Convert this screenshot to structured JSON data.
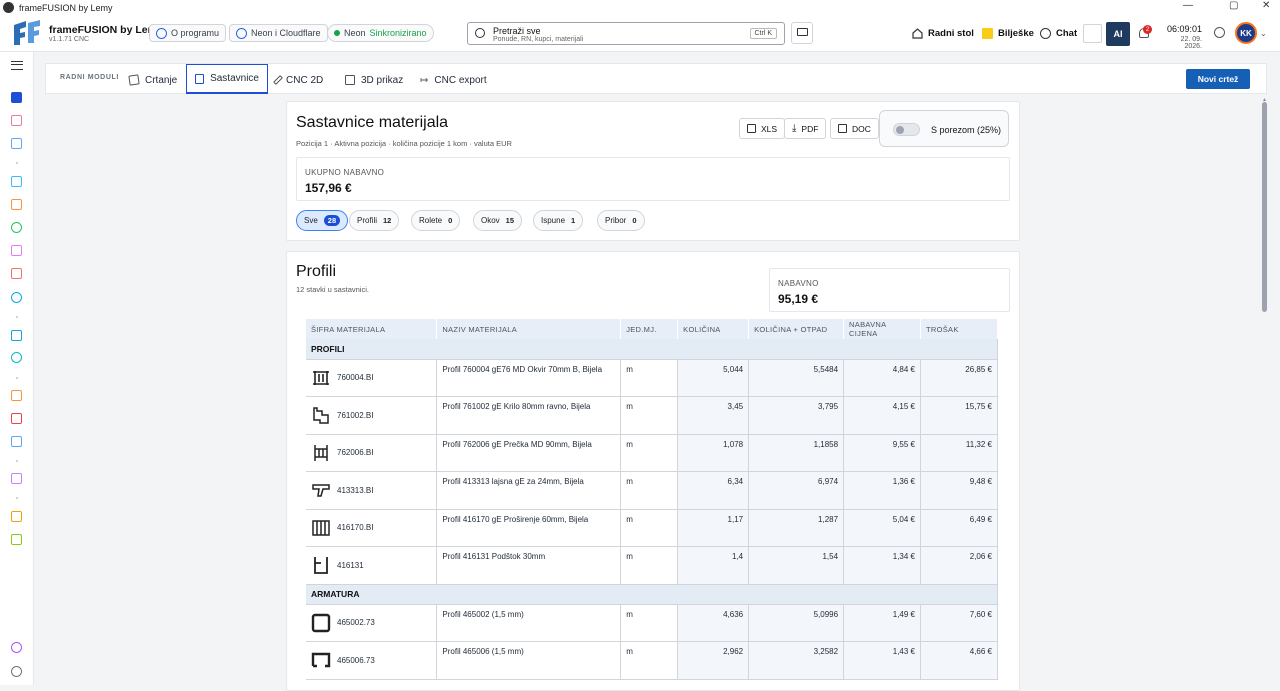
{
  "window": {
    "title": "frameFUSION by Lemy"
  },
  "brand": {
    "name": "frameFUSION by Lemy",
    "version": "v1.1.71 CNC"
  },
  "header": {
    "about_label": "O programu",
    "neon_cloudflare_label": "Neon i Cloudflare",
    "neon_label": "Neon",
    "neon_status": "Sinkronizirano",
    "search_title": "Pretraži sve",
    "search_sub": "Ponude, RN, kupci, materijali",
    "search_shortcut": "Ctrl K",
    "desktop_label": "Radni stol",
    "notes_label": "Bilješke",
    "chat_label": "Chat",
    "ai_label": "AI",
    "notif_count": "2",
    "time": "06:09:01",
    "date": "22. 09. 2026.",
    "user_initials": "KK"
  },
  "modules": {
    "label": "RADNI MODULI",
    "tabs": [
      {
        "label": "Crtanje"
      },
      {
        "label": "Sastavnice"
      },
      {
        "label": "CNC 2D"
      },
      {
        "label": "3D prikaz"
      },
      {
        "label": "CNC export"
      }
    ],
    "new_drawing": "Novi crtež"
  },
  "summary": {
    "title": "Sastavnice materijala",
    "subtitle": "Pozicija 1 · Aktivna pozicija · količina pozicije 1 kom · valuta EUR",
    "export": {
      "xls": "XLS",
      "pdf": "PDF",
      "doc": "DOC"
    },
    "tax_label": "S porezom (25%)",
    "total_label": "UKUPNO NABAVNO",
    "total_value": "157,96 €",
    "filters": [
      {
        "label": "Sve",
        "count": "28"
      },
      {
        "label": "Profili",
        "count": "12"
      },
      {
        "label": "Rolete",
        "count": "0"
      },
      {
        "label": "Okov",
        "count": "15"
      },
      {
        "label": "Ispune",
        "count": "1"
      },
      {
        "label": "Pribor",
        "count": "0"
      }
    ]
  },
  "profili": {
    "title": "Profili",
    "subtitle": "12 stavki u sastavnici.",
    "nab_label": "NABAVNO",
    "nab_value": "95,19 €",
    "columns": [
      "ŠIFRA MATERIJALA",
      "NAZIV MATERIJALA",
      "JED.MJ.",
      "KOLIČINA",
      "KOLIČINA + OTPAD",
      "NABAVNA CIJENA",
      "TROŠAK"
    ],
    "groups": [
      {
        "name": "PROFILI",
        "rows": [
          {
            "code": "760004.BI",
            "name": "Profil 760004 gE76 MD Okvir 70mm B, Bijela",
            "unit": "m",
            "qty": "5,044",
            "qty_waste": "5,5484",
            "price": "4,84 €",
            "cost": "26,85 €"
          },
          {
            "code": "761002.BI",
            "name": "Profil 761002 gE Krilo 80mm ravno, Bijela",
            "unit": "m",
            "qty": "3,45",
            "qty_waste": "3,795",
            "price": "4,15 €",
            "cost": "15,75 €"
          },
          {
            "code": "762006.BI",
            "name": "Profil 762006 gE Prečka MD 90mm, Bijela",
            "unit": "m",
            "qty": "1,078",
            "qty_waste": "1,1858",
            "price": "9,55 €",
            "cost": "11,32 €"
          },
          {
            "code": "413313.BI",
            "name": "Profil 413313 lajsna gE za 24mm, Bijela",
            "unit": "m",
            "qty": "6,34",
            "qty_waste": "6,974",
            "price": "1,36 €",
            "cost": "9,48 €"
          },
          {
            "code": "416170.BI",
            "name": "Profil 416170 gE Proširenje 60mm, Bijela",
            "unit": "m",
            "qty": "1,17",
            "qty_waste": "1,287",
            "price": "5,04 €",
            "cost": "6,49 €"
          },
          {
            "code": "416131",
            "name": "Profil 416131 Podštok 30mm",
            "unit": "m",
            "qty": "1,4",
            "qty_waste": "1,54",
            "price": "1,34 €",
            "cost": "2,06 €"
          }
        ]
      },
      {
        "name": "ARMATURA",
        "rows": [
          {
            "code": "465002.73",
            "name": "Profil 465002 (1,5 mm)",
            "unit": "m",
            "qty": "4,636",
            "qty_waste": "5,0996",
            "price": "1,49 €",
            "cost": "7,60 €"
          },
          {
            "code": "465006.73",
            "name": "Profil 465006 (1,5 mm)",
            "unit": "m",
            "qty": "2,962",
            "qty_waste": "3,2582",
            "price": "1,43 €",
            "cost": "4,66 €"
          }
        ]
      }
    ]
  }
}
